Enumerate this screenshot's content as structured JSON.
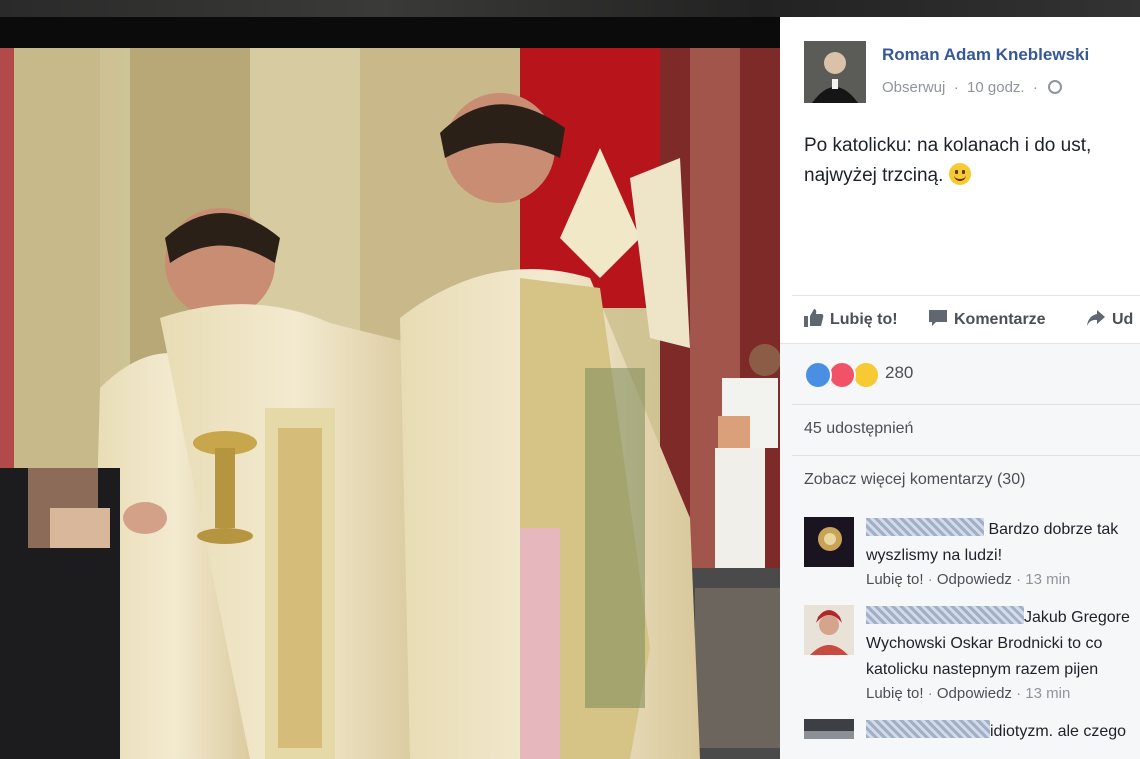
{
  "post": {
    "author": "Roman Adam Kneblewski",
    "follow": "Obserwuj",
    "time": "10 godz.",
    "text_line1": "Po katolicku: na kolanach i do ust,",
    "text_line2": "najwyżej trzciną."
  },
  "actions": {
    "like": "Lubię to!",
    "comment": "Komentarze",
    "share": "Ud"
  },
  "reactions": {
    "count": "280",
    "colors": {
      "like": "#4a90e2",
      "love": "#f25268",
      "haha": "#f7c932"
    }
  },
  "shares": "45 udostępnień",
  "more_comments": "Zobacz więcej komentarzy (30)",
  "comments": [
    {
      "text_line1": "Bardzo dobrze tak",
      "text_line2": "wyszlismy na ludzi!",
      "like": "Lubię to!",
      "reply": "Odpowiedz",
      "time": "13 min"
    },
    {
      "text_line1": "Jakub Gregore",
      "text_line2": "Wychowski Oskar Brodnicki to co",
      "text_line3": "katolicku nastepnym razem pijen",
      "like": "Lubię to!",
      "reply": "Odpowiedz",
      "time": "13 min"
    },
    {
      "text_line1": "idiotyzm. ale czego"
    }
  ]
}
